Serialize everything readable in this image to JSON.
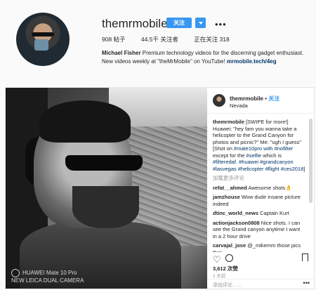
{
  "profile": {
    "username": "themrmobile",
    "follow_label": "关注",
    "more": "•••",
    "posts": "908 帖子",
    "followers": "44.5千 关注者",
    "following": "正在关注 318",
    "bio_name": "Michael Fisher",
    "bio_text": " Premium technology videos for the discerning gadget enthusiast. New videos weekly at \"theMrMobile\" on YouTube! ",
    "bio_link": "mrmobile.tech/4eg"
  },
  "post": {
    "watermark_line1": "HUAWEI Mate 10 Pro",
    "watermark_line2": "NEW LEICA DUAL CAMERA",
    "header_user": "themrmobile",
    "header_dot": " • ",
    "header_follow": "关注",
    "location": "Nevada",
    "caption_user": "themrmobile",
    "caption_text": " [SWIPE for more!] Huawei: \"hey fam you wanna take a helicopter to the Grand Canyon for photos and picnic?\" Me: \"ugh I guess\" [Shot on ",
    "caption_tags": "#mate10pro with #nofilter",
    "caption_text2": " except for the ",
    "caption_tags2": "#selfie",
    "caption_text3": " which is ",
    "caption_tags3": "#filteredaf. #huawei #grandcanyon #lasvegas #helicopter #flight #ces2018",
    "caption_end": "]",
    "load_more": "加载更多评论",
    "comments": [
      {
        "user": "refat__ahmed",
        "text": " Awesome shots👌"
      },
      {
        "user": "jamzhouse",
        "text": " Wow dude insane picture indeed"
      },
      {
        "user": "dtinc_world_news",
        "text": " Captain Kurt"
      },
      {
        "user": "actionjackson0808",
        "text": " Nice shots. I can see the Grand canyon anytime I want in a 2 hour drive"
      },
      {
        "user": "carvajal_jose",
        "text": " @_mikemm those pics tho!"
      }
    ],
    "likes": "3,612 次赞",
    "time_ago": "1 天前",
    "add_comment_placeholder": "添加评论……",
    "more_options": "•••"
  }
}
